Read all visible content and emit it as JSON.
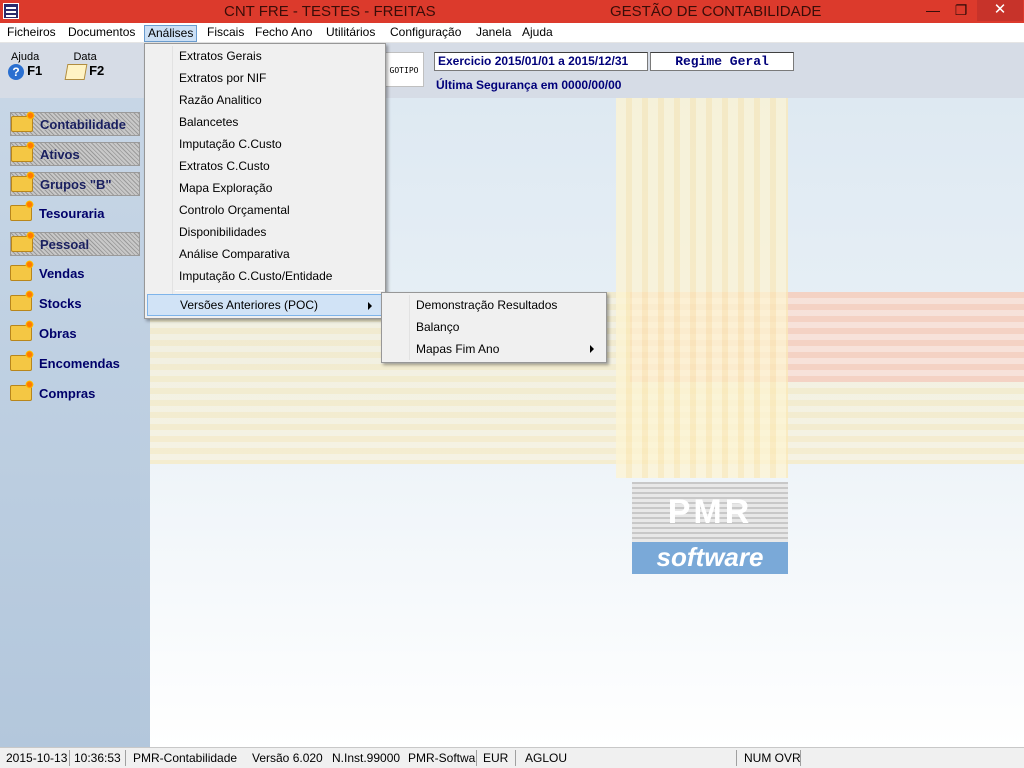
{
  "titlebar": {
    "left_title": "CNT FRE - TESTES - FREITAS",
    "right_title": "GESTÃO DE CONTABILIDADE",
    "minimize": "—",
    "restore": "❐",
    "close": "✕"
  },
  "menubar": {
    "items": [
      "Ficheiros",
      "Documentos",
      "Análises",
      "Fiscais",
      "Fecho Ano",
      "Utilitários",
      "Configuração",
      "Janela",
      "Ajuda"
    ]
  },
  "toolbar": {
    "help_label": "Ajuda",
    "help_key": "F1",
    "date_label": "Data",
    "date_key": "F2",
    "logo_text": "GOTIPO",
    "exercise": "Exercicio 2015/01/01 a 2015/12/31",
    "regime": "Regime Geral",
    "seguranca": "Última Segurança em 0000/00/00"
  },
  "sidebar": {
    "items": [
      {
        "label": "Contabilidade",
        "enabled": false
      },
      {
        "label": "Ativos",
        "enabled": false
      },
      {
        "label": "Grupos \"B\"",
        "enabled": false
      },
      {
        "label": "Tesouraria",
        "enabled": true
      },
      {
        "label": "Pessoal",
        "enabled": false
      },
      {
        "label": "Vendas",
        "enabled": true
      },
      {
        "label": "Stocks",
        "enabled": true
      },
      {
        "label": "Obras",
        "enabled": true
      },
      {
        "label": "Encomendas",
        "enabled": true
      },
      {
        "label": "Compras",
        "enabled": true
      }
    ]
  },
  "analises_menu": {
    "items": [
      "Extratos Gerais",
      "Extratos por NIF",
      "Razão Analitico",
      "Balancetes",
      "Imputação C.Custo",
      "Extratos C.Custo",
      "Mapa Exploração",
      "Controlo Orçamental",
      "Disponibilidades",
      "Análise Comparativa",
      "Imputação C.Custo/Entidade"
    ],
    "highlighted": "Versões Anteriores (POC)"
  },
  "submenu": {
    "items": [
      "Demonstração Resultados",
      "Balanço",
      "Mapas Fim Ano"
    ]
  },
  "logo": {
    "pmr": "PMR",
    "software": "software"
  },
  "statusbar": {
    "date": "2015-10-13",
    "time": "10:36:53",
    "app": "PMR-Contabilidade",
    "version": "Versão  6.020",
    "inst": "N.Inst.99000",
    "company": "PMR-Softwa",
    "currency": "EUR",
    "user": "AGLOU",
    "keys": "NUM OVR"
  }
}
